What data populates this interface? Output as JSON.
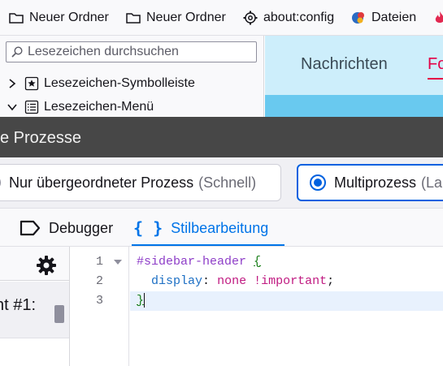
{
  "bookmarks_toolbar": {
    "items": [
      {
        "label": "Neuer Ordner",
        "icon": "folder-icon"
      },
      {
        "label": "Neuer Ordner",
        "icon": "folder-icon"
      },
      {
        "label": "about:config",
        "icon": "gear-icon"
      },
      {
        "label": "Dateien",
        "icon": "dateien-favicon"
      },
      {
        "label": "",
        "icon": "fire-icon"
      }
    ]
  },
  "sidebar": {
    "search_placeholder": "Lesezeichen durchsuchen",
    "tree": [
      {
        "label": "Lesezeichen-Symbolleiste",
        "expanded": false,
        "icon": "bookmarks-toolbar-icon"
      },
      {
        "label": "Lesezeichen-Menü",
        "expanded": true,
        "icon": "bookmarks-menu-icon"
      }
    ]
  },
  "web_content": {
    "nav": [
      "Nachrichten",
      "Fo"
    ],
    "colors": {
      "header_bg": "#cdeefb",
      "accent": "#e40046",
      "band": "#69c9ef"
    }
  },
  "processes_dialog": {
    "title": "e Prozesse",
    "options": [
      {
        "label": "Nur übergeordneter Prozess",
        "hint": "(Schnell)",
        "selected": false
      },
      {
        "label": "Multiprozess",
        "hint": "(La",
        "selected": true
      }
    ]
  },
  "devtools": {
    "tabs": [
      {
        "label": "Debugger",
        "icon": "debugger-icon",
        "selected": false
      },
      {
        "label": "Stilbearbeitung",
        "icon": "style-editor-icon",
        "selected": true
      }
    ],
    "sheet_list": {
      "item_name": "nt #1:"
    },
    "editor": {
      "line_numbers": [
        "1",
        "2",
        "3"
      ],
      "code": {
        "selector": "#sidebar-header",
        "open_brace": "{",
        "property": "display",
        "colon": ":",
        "value": "none !important",
        "semicolon": ";",
        "close_brace": "}"
      }
    }
  }
}
